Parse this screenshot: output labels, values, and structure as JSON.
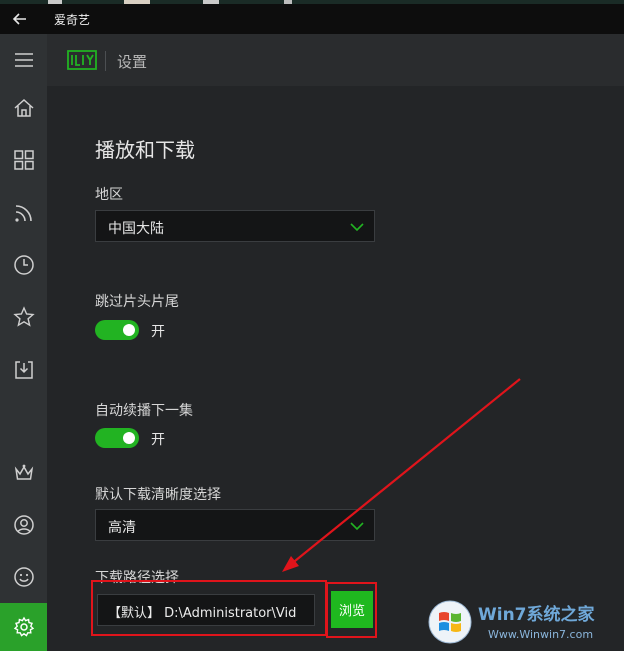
{
  "window": {
    "title": "爱奇艺"
  },
  "header": {
    "crumb": "设置"
  },
  "sidebar": {
    "icons": [
      "menu-icon",
      "home-icon",
      "grid-icon",
      "rss-icon",
      "clock-icon",
      "star-icon",
      "download-icon",
      "crown-icon",
      "user-icon",
      "smile-icon",
      "gear-icon"
    ],
    "active": "gear-icon"
  },
  "settings": {
    "section_title": "播放和下载",
    "region": {
      "label": "地区",
      "value": "中国大陆"
    },
    "skip_intro": {
      "label": "跳过片头片尾",
      "state_text": "开",
      "on": true
    },
    "autoplay_next": {
      "label": "自动续播下一集",
      "state_text": "开",
      "on": true
    },
    "default_quality": {
      "label": "默认下载清晰度选择",
      "value": "高清"
    },
    "download_path": {
      "label": "下载路径选择",
      "value": "【默认】 D:\\Administrator\\Vid",
      "browse_label": "浏览"
    }
  },
  "colors": {
    "accent": "#22b322",
    "annotation": "#e0141b",
    "background": "#232527"
  },
  "watermark": {
    "brand": "Win7系统之家",
    "url": "Www.Winwin7.com"
  }
}
